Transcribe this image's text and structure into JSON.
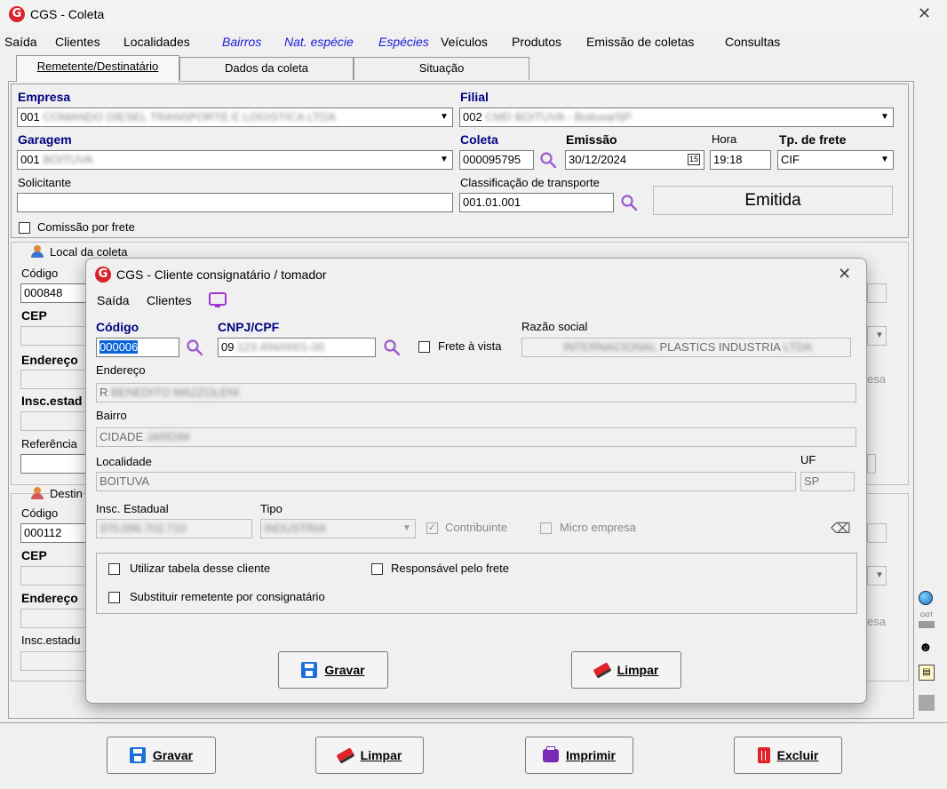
{
  "window": {
    "title": "CGS - Coleta",
    "logo": "G"
  },
  "menu": {
    "items": [
      "Saída",
      "Clientes",
      "Localidades"
    ],
    "italic_items": [
      "Bairros",
      "Nat. espécie",
      "Espécies"
    ],
    "more_items": [
      "Veículos",
      "Produtos",
      "Emissão de coletas",
      "Consultas"
    ]
  },
  "tabs": [
    "Remetente/Destinatário",
    "Dados da coleta",
    "Situação"
  ],
  "form": {
    "empresa_label": "Empresa",
    "empresa_value": "001",
    "filial_label": "Filial",
    "filial_value": "002",
    "garagem_label": "Garagem",
    "garagem_value": "001",
    "coleta_label": "Coleta",
    "coleta_value": "000095795",
    "emissao_label": "Emissão",
    "emissao_value": "30/12/2024",
    "hora_label": "Hora",
    "hora_value": "19:18",
    "tpfrete_label": "Tp. de frete",
    "tpfrete_value": "CIF",
    "solicitante_label": "Solicitante",
    "classificacao_label": "Classificação de transporte",
    "classificacao_value": "001.01.001",
    "status": "Emitida",
    "comissao_label": "Comissão por frete"
  },
  "local": {
    "group": "Local da coleta",
    "codigo_label": "Código",
    "codigo_value": "000848",
    "cep_label": "CEP",
    "endereco_label": "Endereço",
    "insc_label": "Insc.estad",
    "referencia_label": "Referência"
  },
  "destino": {
    "group": "Destin",
    "codigo_label": "Código",
    "codigo_value": "000112",
    "cep_label": "CEP",
    "endereco_label": "Endereço",
    "insc_label": "Insc.estadu"
  },
  "partial_right": {
    "empresa_suffix": "esa"
  },
  "dialog": {
    "title": "CGS - Cliente consignatário / tomador",
    "menu": [
      "Saída",
      "Clientes"
    ],
    "codigo_label": "Código",
    "codigo_value": "000006",
    "cnpj_label": "CNPJ/CPF",
    "cnpj_value": "09",
    "frete_vista_label": "Frete à vista",
    "razao_label": "Razão social",
    "razao_value": "PLASTICS INDUSTRIA",
    "endereco_label": "Endereço",
    "endereco_value": "R",
    "bairro_label": "Bairro",
    "bairro_value": "CIDADE",
    "localidade_label": "Localidade",
    "localidade_value": "BOITUVA",
    "uf_label": "UF",
    "uf_value": "SP",
    "insc_label": "Insc. Estadual",
    "tipo_label": "Tipo",
    "contribuinte_label": "Contribuinte",
    "micro_label": "Micro empresa",
    "opt1": "Utilizar tabela desse cliente",
    "opt2": "Responsável pelo frete",
    "opt3": "Substituir remetente por consignatário",
    "gravar": "Gravar",
    "limpar": "Limpar"
  },
  "buttons": {
    "gravar": "Gravar",
    "limpar": "Limpar",
    "imprimir": "Imprimir",
    "excluir": "Excluir"
  },
  "side": {
    "ciot": "CIOT"
  },
  "colors": {
    "accent": "#000080",
    "logo": "#d8232a",
    "link": "#1a1adb",
    "search": "#9b59d0",
    "save": "#1e6fd9",
    "erase": "#e0222a",
    "print": "#7a2bb5",
    "delete": "#e0222a"
  }
}
